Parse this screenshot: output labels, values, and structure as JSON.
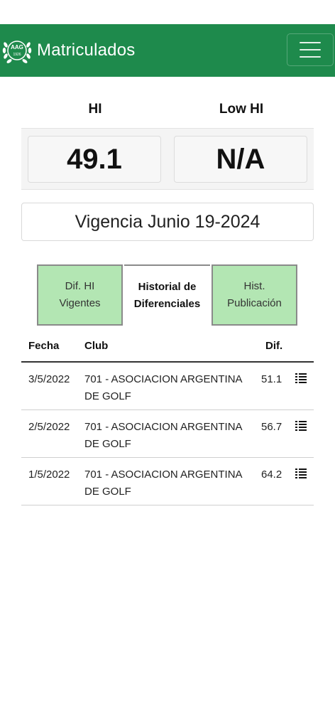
{
  "navbar": {
    "brand": "Matriculados",
    "logo_text_top": "AAG",
    "logo_text_bottom": "1926",
    "menu_icon": "hamburger-icon"
  },
  "handicap": {
    "hi_label": "HI",
    "low_hi_label": "Low HI",
    "hi_value": "49.1",
    "low_hi_value": "N/A"
  },
  "vigencia": "Vigencia Junio 19-2024",
  "tabs": [
    {
      "line1": "Dif. HI",
      "line2": "Vigentes",
      "active": false
    },
    {
      "line1": "Historial de",
      "line2": "Diferenciales",
      "active": true
    },
    {
      "line1": "Hist.",
      "line2": "Publicación",
      "active": false
    }
  ],
  "table": {
    "headers": {
      "fecha": "Fecha",
      "club": "Club",
      "dif": "Dif."
    },
    "rows": [
      {
        "fecha": "3/5/2022",
        "club": "701 - ASOCIACION ARGENTINA DE GOLF",
        "dif": "51.1",
        "icon": "list-icon"
      },
      {
        "fecha": "2/5/2022",
        "club": "701 - ASOCIACION ARGENTINA DE GOLF",
        "dif": "56.7",
        "icon": "list-icon"
      },
      {
        "fecha": "1/5/2022",
        "club": "701 - ASOCIACION ARGENTINA DE GOLF",
        "dif": "64.2",
        "icon": "list-icon"
      }
    ]
  },
  "colors": {
    "navbar": "#1e8a4c",
    "tab_inactive": "#b3e6b3"
  }
}
